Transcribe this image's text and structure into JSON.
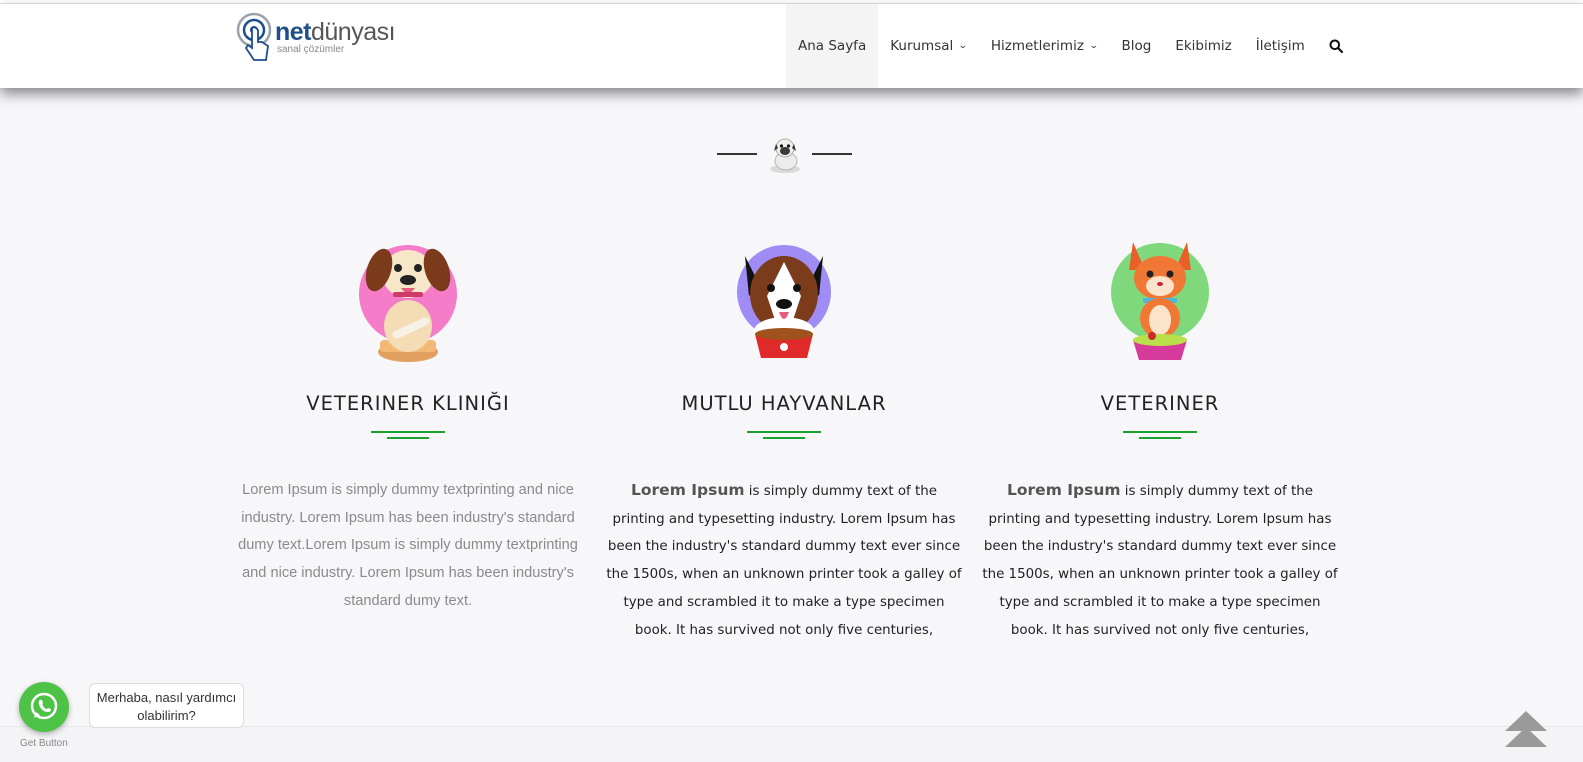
{
  "brand": {
    "name_bold": "net",
    "name_rest": "dünyası",
    "tagline": "sanal çözümler"
  },
  "nav": {
    "items": [
      {
        "label": "Ana Sayfa"
      },
      {
        "label": "Kurumsal"
      },
      {
        "label": "Hizmetlerimiz"
      },
      {
        "label": "Blog"
      },
      {
        "label": "Ekibimiz"
      },
      {
        "label": "İletişim"
      }
    ]
  },
  "features": [
    {
      "title": "VETERINER KLINIĞI",
      "text": "Lorem Ipsum is simply dummy textprinting and nice industry. Lorem Ipsum has been industry's standard dumy text.Lorem Ipsum is simply dummy textprinting and nice industry. Lorem Ipsum has been industry's standard dumy text.",
      "accent": "#f47cc8"
    },
    {
      "title": "MUTLU HAYVANLAR",
      "text_bold": "Lorem Ipsum",
      "text": " is simply dummy text of the printing and typesetting industry. Lorem Ipsum has been the industry's standard dummy text ever since the 1500s, when an unknown printer took a galley of type and scrambled it to make a type specimen book. It has survived not only five centuries,",
      "accent": "#9f8cf5"
    },
    {
      "title": "VETERINER",
      "text_bold": "Lorem Ipsum",
      "text": " is simply dummy text of the printing and typesetting industry. Lorem Ipsum has been the industry's standard dummy text ever since the 1500s, when an unknown printer took a galley of type and scrambled it to make a type specimen book. It has survived not only five centuries,",
      "accent": "#7fd87c"
    }
  ],
  "whatsapp": {
    "message": "Merhaba, nasıl yardımcı olabilirim?",
    "label": "Get Button"
  },
  "colors": {
    "underline": "#1aa12e",
    "whatsapp_green": "#4dc247",
    "brand_blue": "#1d4f8c"
  }
}
